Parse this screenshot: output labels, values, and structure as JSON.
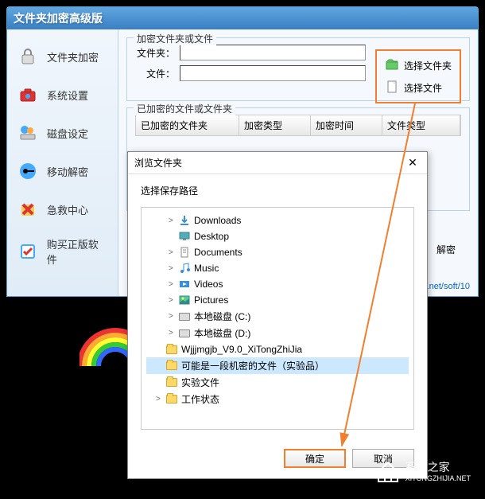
{
  "main": {
    "title": "文件夹加密高级版",
    "sidebar": [
      {
        "label": "文件夹加密",
        "icon": "lock-icon"
      },
      {
        "label": "系统设置",
        "icon": "toolbox-icon"
      },
      {
        "label": "磁盘设定",
        "icon": "disk-icon"
      },
      {
        "label": "移动解密",
        "icon": "key-icon"
      },
      {
        "label": "急救中心",
        "icon": "cross-icon"
      },
      {
        "label": "购买正版软件",
        "icon": "check-icon"
      }
    ],
    "fieldset1": {
      "legend": "加密文件夹或文件",
      "folder_label": "文件夹：",
      "file_label": "文件：",
      "select_folder": "选择文件夹",
      "select_file": "选择文件"
    },
    "fieldset2": {
      "legend": "已加密的文件或文件夹",
      "columns": [
        "已加密的文件夹",
        "加密类型",
        "加密时间",
        "文件类型"
      ]
    },
    "decrypt_label": "解密",
    "footer_link": ".net/soft/10"
  },
  "dialog": {
    "title": "浏览文件夹",
    "close": "✕",
    "subtitle": "选择保存路径",
    "tree": [
      {
        "indent": 1,
        "arrow": ">",
        "icon": "download",
        "label": "Downloads"
      },
      {
        "indent": 1,
        "arrow": "",
        "icon": "desktop",
        "label": "Desktop"
      },
      {
        "indent": 1,
        "arrow": ">",
        "icon": "document",
        "label": "Documents"
      },
      {
        "indent": 1,
        "arrow": ">",
        "icon": "music",
        "label": "Music"
      },
      {
        "indent": 1,
        "arrow": ">",
        "icon": "video",
        "label": "Videos"
      },
      {
        "indent": 1,
        "arrow": ">",
        "icon": "picture",
        "label": "Pictures"
      },
      {
        "indent": 1,
        "arrow": ">",
        "icon": "disk",
        "label": "本地磁盘 (C:)"
      },
      {
        "indent": 1,
        "arrow": ">",
        "icon": "disk",
        "label": "本地磁盘 (D:)"
      },
      {
        "indent": 0,
        "arrow": "",
        "icon": "folder",
        "label": "Wjjjmgjb_V9.0_XiTongZhiJia"
      },
      {
        "indent": 0,
        "arrow": "",
        "icon": "folder",
        "label": "可能是一段机密的文件（实验品）",
        "selected": true
      },
      {
        "indent": 0,
        "arrow": "",
        "icon": "folder",
        "label": "实验文件"
      },
      {
        "indent": 0,
        "arrow": ">",
        "icon": "folder",
        "label": "工作状态"
      }
    ],
    "ok": "确定",
    "cancel": "取消"
  },
  "watermark": {
    "brand": "系统之家",
    "url": "XITONGZHIJIA.NET"
  }
}
